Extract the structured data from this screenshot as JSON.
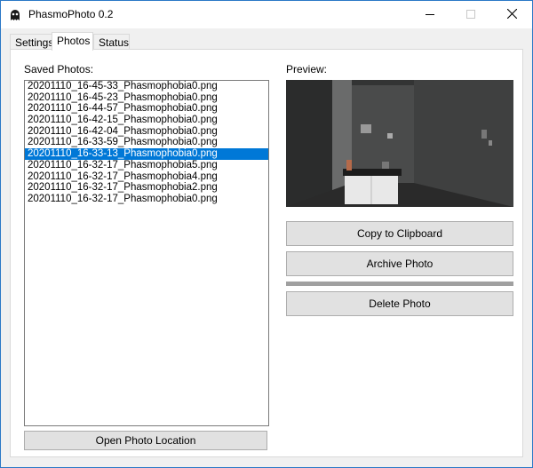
{
  "window": {
    "title": "PhasmoPhoto 0.2"
  },
  "titlebar_buttons": {
    "minimize": "minimize-icon",
    "maximize": "maximize-icon",
    "close": "close-icon"
  },
  "tabs": [
    {
      "label": "Settings"
    },
    {
      "label": "Photos",
      "active": true
    },
    {
      "label": "Status"
    }
  ],
  "photos": {
    "list_label": "Saved Photos:",
    "items": [
      "20201110_16-45-33_Phasmophobia0.png",
      "20201110_16-45-23_Phasmophobia0.png",
      "20201110_16-44-57_Phasmophobia0.png",
      "20201110_16-42-15_Phasmophobia0.png",
      "20201110_16-42-04_Phasmophobia0.png",
      "20201110_16-33-59_Phasmophobia0.png",
      "20201110_16-33-13_Phasmophobia0.png",
      "20201110_16-32-17_Phasmophobia5.png",
      "20201110_16-32-17_Phasmophobia4.png",
      "20201110_16-32-17_Phasmophobia2.png",
      "20201110_16-32-17_Phasmophobia0.png"
    ],
    "selected_index": 6,
    "preview_label": "Preview:",
    "copy_button": "Copy to Clipboard",
    "archive_button": "Archive Photo",
    "delete_button": "Delete Photo",
    "open_location_button": "Open Photo Location"
  },
  "colors": {
    "selection": "#0078d7",
    "window_border": "#2b78c6",
    "face": "#f0f0f0"
  }
}
